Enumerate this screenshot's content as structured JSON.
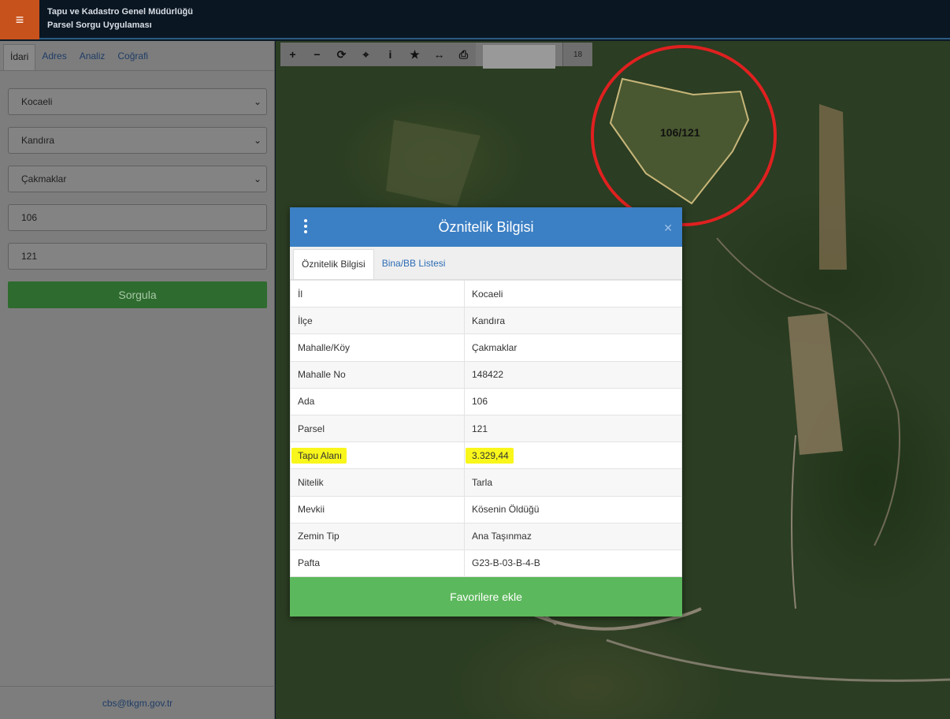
{
  "header": {
    "menu_icon": "hamburger-icon",
    "title_line1": "Tapu ve Kadastro Genel Müdürlüğü",
    "title_line2": "Parsel Sorgu Uygulaması",
    "accent_color": "#c8521c"
  },
  "sidebar": {
    "tabs": [
      "İdari",
      "Adres",
      "Analiz",
      "Coğrafi"
    ],
    "active_tab": "İdari",
    "fields": {
      "il": "Kocaeli",
      "ilce": "Kandıra",
      "mahalle": "Çakmaklar",
      "ada": "106",
      "parsel": "121"
    },
    "query_button": "Sorgula",
    "footer_email": "cbs@tkgm.gov.tr"
  },
  "map": {
    "tools": [
      "zoom-in-icon",
      "zoom-out-icon",
      "refresh-icon",
      "locate-icon",
      "info-icon",
      "star-icon",
      "measure-icon",
      "print-icon"
    ],
    "zoom_level": "18",
    "parcel_label": "106/121",
    "highlight_color": "#e02020"
  },
  "modal": {
    "title": "Öznitelik Bilgisi",
    "tabs": [
      "Öznitelik Bilgisi",
      "Bina/BB Listesi"
    ],
    "rows": [
      {
        "key": "İl",
        "value": "Kocaeli"
      },
      {
        "key": "İlçe",
        "value": "Kandıra"
      },
      {
        "key": "Mahalle/Köy",
        "value": "Çakmaklar"
      },
      {
        "key": "Mahalle No",
        "value": "148422"
      },
      {
        "key": "Ada",
        "value": "106"
      },
      {
        "key": "Parsel",
        "value": "121"
      },
      {
        "key": "Tapu Alanı",
        "value": "3.329,44"
      },
      {
        "key": "Nitelik",
        "value": "Tarla"
      },
      {
        "key": "Mevkii",
        "value": "Kösenin Öldüğü"
      },
      {
        "key": "Zemin Tip",
        "value": "Ana Taşınmaz"
      },
      {
        "key": "Pafta",
        "value": "G23-B-03-B-4-B"
      }
    ],
    "favorite_button": "Favorilere ekle",
    "header_color": "#3b7fc4",
    "button_color": "#5cb85c"
  }
}
